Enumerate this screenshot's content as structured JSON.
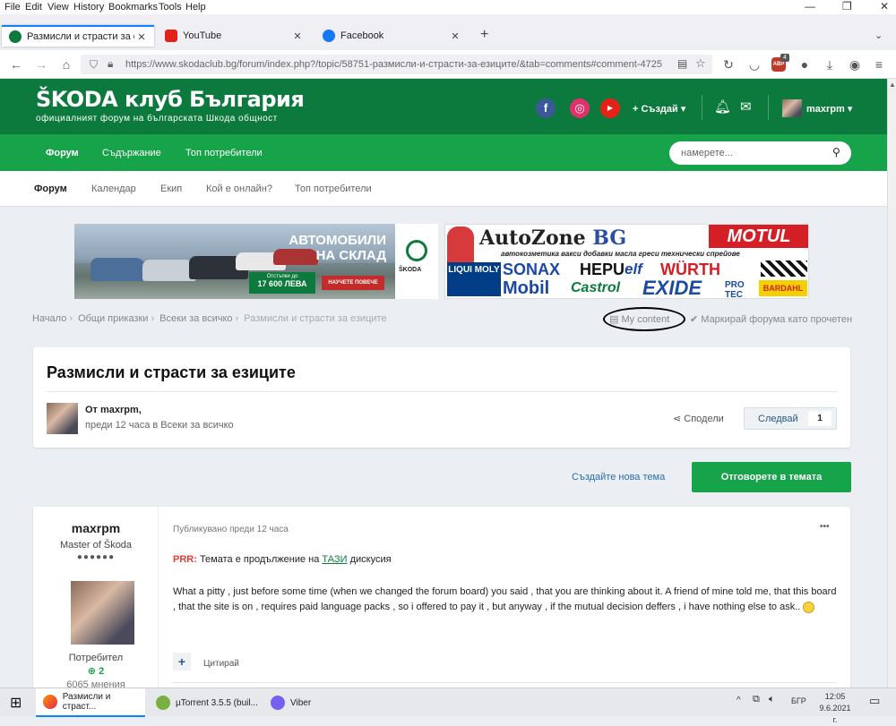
{
  "menubar": {
    "items": [
      "File",
      "Edit",
      "View",
      "History",
      "Bookmarks",
      "Tools",
      "Help"
    ]
  },
  "tabs": [
    {
      "label": "Размисли и страсти за езиците",
      "icon": "skoda-favicon",
      "active": true
    },
    {
      "label": "YouTube",
      "icon": "youtube-favicon",
      "active": false
    },
    {
      "label": "Facebook",
      "icon": "facebook-favicon",
      "active": false
    }
  ],
  "navbar": {
    "url": "https://www.skodaclub.bg/forum/index.php?/topic/58751-размисли-и-страсти-за-езиците/&tab=comments#comment-4725",
    "abp_badge": "4"
  },
  "site": {
    "title": "ŠKODA клуб България",
    "subtitle": "официалният форум на българската Шкода общност",
    "create_label": "Създай",
    "username": "maxrpm"
  },
  "mainnav": {
    "items": [
      "Форум",
      "Съдържание",
      "Топ потребители"
    ],
    "search_placeholder": "намерете..."
  },
  "subnav": {
    "items": [
      "Форум",
      "Календар",
      "Екип",
      "Кой е онлайн?",
      "Топ потребители"
    ]
  },
  "banner1": {
    "headline1": "АВТОМОБИЛИ",
    "headline2": "НА СКЛАД",
    "discount_label": "Отстъпки до",
    "discount_value": "17 600 ЛЕВА",
    "cta": "НАУЧЕТЕ ПОВЕЧЕ",
    "brand": "ŠKODA"
  },
  "banner2": {
    "title_a": "AutoZone",
    "title_b": "BG",
    "motul": "MOTUL",
    "tagline": "автокозметика вакси добавки масла греси технически спрейове",
    "brands": [
      "LIQUI MOLY",
      "SONAX",
      "HEPU",
      "elf",
      "WÜRTH",
      "Mobil",
      "Castrol",
      "EXIDE",
      "PRO TEC",
      "BARDAHL"
    ]
  },
  "breadcrumb": {
    "items": [
      "Начало",
      "Общи приказки",
      "Всеки за всичко",
      "Размисли и страсти за езиците"
    ],
    "my_content": "My content",
    "mark_read": "Маркирай форума като прочетен"
  },
  "topic": {
    "title": "Размисли и страсти за езиците",
    "by_label": "От maxrpm,",
    "meta": "преди 12 часа в Всеки за всичко",
    "share_label": "Сподели",
    "follow_label": "Следвай",
    "follow_count": "1"
  },
  "actions": {
    "new_topic": "Създайте нова тема",
    "reply": "Отговорете в темата"
  },
  "post": {
    "author": "maxrpm",
    "rank": "Master of Škoda",
    "rank_dots": "●●●●●●",
    "role": "Потребител",
    "reputation": "2",
    "post_count": "6065 мнения",
    "published": "Публикувано преди 12 часа",
    "prr_label": "PRR:",
    "line1_text": " Темата е продължение на ",
    "line1_link": "ТАЗИ",
    "line1_end": " дискусия",
    "body": "What a pitty , just before some time (when we changed the forum board)  you said , that you are thinking about it. A friend of mine told me, that this board , that the site is on , requires paid language packs , so i offered to pay it , but anyway , if the mutual decision deffers , i have nothing else to ask..",
    "quote_label": "Цитирай",
    "more": "•••"
  },
  "taskbar": {
    "items": [
      {
        "label": "Размисли и страст...",
        "icon": "firefox-icon"
      },
      {
        "label": "µTorrent 3.5.5  (buil...",
        "icon": "utorrent-icon"
      },
      {
        "label": "Viber",
        "icon": "viber-icon"
      }
    ],
    "language": "БГР",
    "time": "12:05",
    "date": "9.6.2021 г."
  },
  "colors": {
    "header_green": "#0d7a3d",
    "nav_green": "#16a34a",
    "link_blue": "#2a6ea8",
    "prr_red": "#e03c31"
  }
}
